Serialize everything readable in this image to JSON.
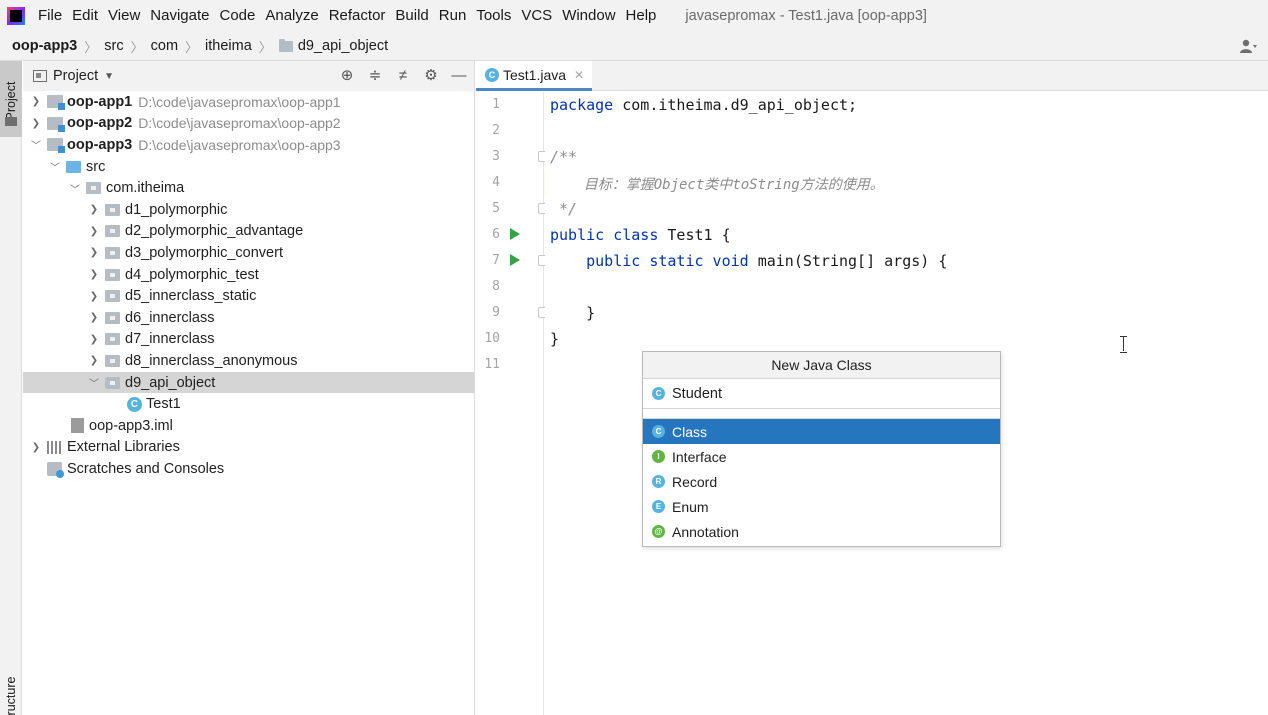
{
  "menubar": {
    "items": [
      "File",
      "Edit",
      "View",
      "Navigate",
      "Code",
      "Analyze",
      "Refactor",
      "Build",
      "Run",
      "Tools",
      "VCS",
      "Window",
      "Help"
    ],
    "window_title": "javasepromax - Test1.java [oop-app3]"
  },
  "breadcrumb": {
    "items": [
      "oop-app3",
      "src",
      "com",
      "itheima",
      "d9_api_object"
    ]
  },
  "toolstrip": {
    "project_tab": "Project",
    "structure_tab": "ructure"
  },
  "project_panel": {
    "title": "Project",
    "tree": [
      {
        "label": "oop-app1",
        "path": "D:\\code\\javasepromax\\oop-app1"
      },
      {
        "label": "oop-app2",
        "path": "D:\\code\\javasepromax\\oop-app2"
      },
      {
        "label": "oop-app3",
        "path": "D:\\code\\javasepromax\\oop-app3"
      },
      {
        "label": "src"
      },
      {
        "label": "com.itheima"
      },
      {
        "label": "d1_polymorphic"
      },
      {
        "label": "d2_polymorphic_advantage"
      },
      {
        "label": "d3_polymorphic_convert"
      },
      {
        "label": "d4_polymorphic_test"
      },
      {
        "label": "d5_innerclass_static"
      },
      {
        "label": "d6_innerclass"
      },
      {
        "label": "d7_innerclass"
      },
      {
        "label": "d8_innerclass_anonymous"
      },
      {
        "label": "d9_api_object"
      },
      {
        "label": "Test1"
      },
      {
        "label": "oop-app3.iml"
      },
      {
        "label": "External Libraries"
      },
      {
        "label": "Scratches and Consoles"
      }
    ]
  },
  "editor": {
    "tab_label": "Test1.java",
    "line_numbers": [
      "1",
      "2",
      "3",
      "4",
      "5",
      "6",
      "7",
      "8",
      "9",
      "10",
      "11"
    ],
    "code": {
      "l1_kw": "package",
      "l1_rest": " com.itheima.d9_api_object;",
      "l3": "/**",
      "l4": "    目标：掌握Object类中toString方法的使用。",
      "l5": " */",
      "l6_kw": "public class",
      "l6_rest": " Test1 {",
      "l7_kw": "    public static void",
      "l7_rest": " main(String[] args) {",
      "l9": "    }",
      "l10": "}"
    }
  },
  "popup": {
    "title": "New Java Class",
    "input_value": "Student",
    "items": [
      {
        "label": "Class",
        "icon": "C",
        "color": "#55b3e0"
      },
      {
        "label": "Interface",
        "icon": "I",
        "color": "#62b543"
      },
      {
        "label": "Record",
        "icon": "R",
        "color": "#55b3e0"
      },
      {
        "label": "Enum",
        "icon": "E",
        "color": "#55b3e0"
      },
      {
        "label": "Annotation",
        "icon": "@",
        "color": "#62b543"
      }
    ],
    "selected": "Class"
  },
  "colors": {
    "accent": "#2675bf",
    "keyword": "#0033b3",
    "comment": "#8c8c8c",
    "selection_gray": "#d5d5d5"
  }
}
